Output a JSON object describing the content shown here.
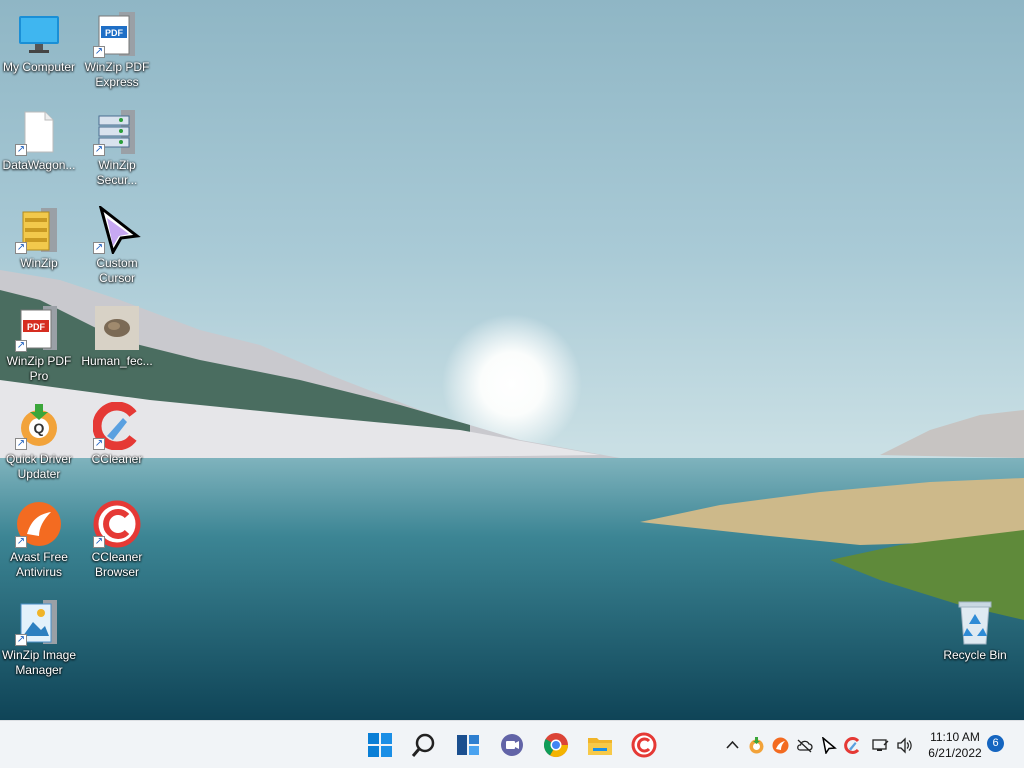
{
  "desktop": {
    "icons": [
      {
        "label": "My Computer",
        "icon": "monitor-icon"
      },
      {
        "label": "WinZip PDF\nExpress",
        "icon": "winzip-pdf-express-icon"
      },
      {
        "label": "DataWagon...",
        "icon": "blank-file-icon"
      },
      {
        "label": "WinZip\nSecur...",
        "icon": "winzip-secure-icon"
      },
      {
        "label": "WinZip",
        "icon": "winzip-icon"
      },
      {
        "label": "Custom\nCursor",
        "icon": "cursor-icon"
      },
      {
        "label": "WinZip PDF\nPro",
        "icon": "winzip-pdf-pro-icon"
      },
      {
        "label": "Human_fec...",
        "icon": "image-thumbnail-icon"
      },
      {
        "label": "Quick Driver\nUpdater",
        "icon": "quick-driver-updater-icon"
      },
      {
        "label": "CCleaner",
        "icon": "ccleaner-icon"
      },
      {
        "label": "Avast Free\nAntivirus",
        "icon": "avast-icon"
      },
      {
        "label": "CCleaner\nBrowser",
        "icon": "ccleaner-browser-icon"
      },
      {
        "label": "WinZip Image\nManager",
        "icon": "winzip-image-manager-icon"
      }
    ],
    "recycle_bin": {
      "label": "Recycle Bin",
      "icon": "recycle-bin-icon"
    }
  },
  "taskbar": {
    "pinned": [
      "start-icon",
      "search-icon",
      "widgets-icon",
      "teams-chat-icon",
      "chrome-icon",
      "file-explorer-icon",
      "ccleaner-browser-icon"
    ],
    "tray": [
      "chevron-up-icon",
      "quick-driver-tray-icon",
      "avast-tray-icon",
      "cloud-offline-icon",
      "cursor-tray-icon",
      "ccleaner-tray-icon",
      "network-icon",
      "volume-icon"
    ],
    "clock": {
      "time": "11:10 AM",
      "date": "6/21/2022"
    },
    "notifications": "6"
  },
  "colors": {
    "taskbar_bg": "#f1f4f7",
    "accent": "#0078d4",
    "badge": "#1565c0"
  }
}
